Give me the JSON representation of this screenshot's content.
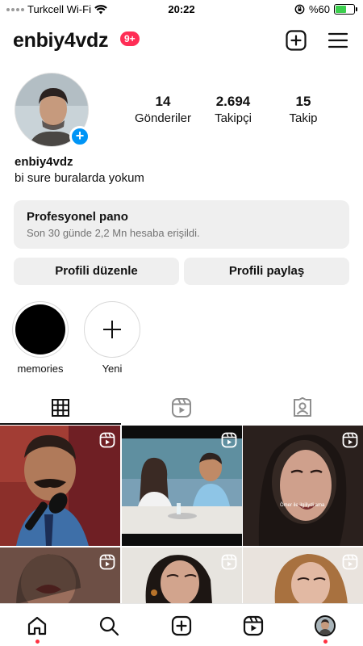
{
  "status_bar": {
    "carrier": "Turkcell Wi-Fi",
    "time": "20:22",
    "battery_percent": "%60",
    "battery_level": 0.6,
    "battery_color": "#3ccf4e"
  },
  "header": {
    "username": "enbiy4vdz",
    "notification_badge": "9+",
    "icons": [
      "add-post-icon",
      "menu-icon"
    ]
  },
  "profile": {
    "stats": [
      {
        "value": "14",
        "label": "Gönderiler"
      },
      {
        "value": "2.694",
        "label": "Takipçi"
      },
      {
        "value": "15",
        "label": "Takip"
      }
    ],
    "display_name": "enbiy4vdz",
    "bio": "bi sure buralarda yokum"
  },
  "professional_dashboard": {
    "title": "Profesyonel pano",
    "subtitle": "Son 30 günde 2,2 Mn hesaba erişildi."
  },
  "buttons": {
    "edit_profile": "Profili düzenle",
    "share_profile": "Profili paylaş"
  },
  "highlights": [
    {
      "label": "memories"
    },
    {
      "label": "Yeni"
    }
  ],
  "tabs": [
    "grid-icon",
    "reels-icon",
    "tagged-icon"
  ],
  "posts": [
    {
      "caption": ""
    },
    {
      "caption": ""
    },
    {
      "caption": "Ömer ile ilgiliydi ama"
    },
    {
      "caption": ""
    },
    {
      "caption": ""
    },
    {
      "caption": ""
    }
  ],
  "bottom_nav": [
    "home-icon",
    "search-icon",
    "create-icon",
    "reels-icon",
    "profile-avatar"
  ],
  "colors": {
    "accent": "#0095f6",
    "badge": "#ff2d55",
    "notification_dot": "#ff3040"
  }
}
